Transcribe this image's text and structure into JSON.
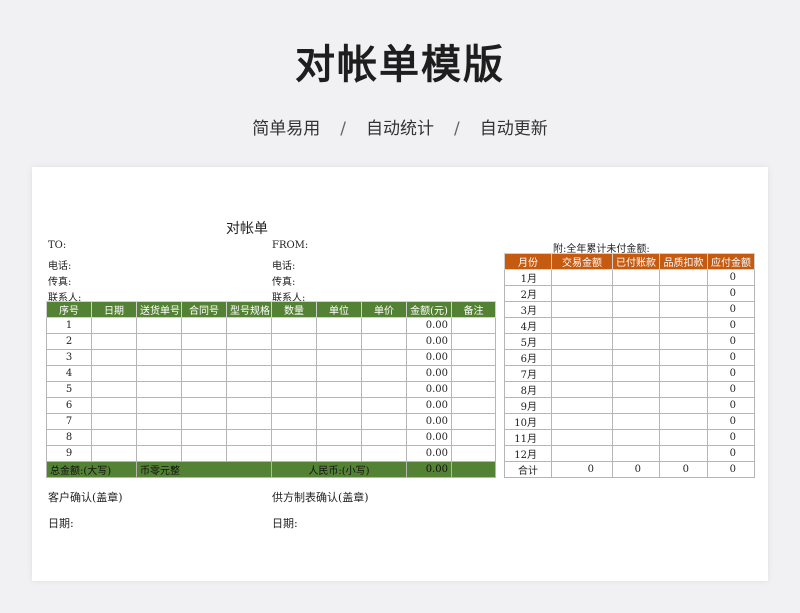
{
  "hero": {
    "title": "对帐单模版",
    "features": [
      "简单易用",
      "自动统计",
      "自动更新"
    ],
    "separator": "/"
  },
  "doc": {
    "title": "对帐单",
    "left_fields": [
      "TO:",
      "电话:",
      "传真:",
      "联系人:"
    ],
    "right_fields": [
      "FROM:",
      "电话:",
      "传真:",
      "联系人:"
    ],
    "side_title": "附:全年累计未付金额:",
    "main_table": {
      "headers": [
        "序号",
        "日期",
        "送货单号",
        "合同号",
        "型号规格",
        "数量",
        "单位",
        "单价",
        "金额(元)",
        "备注"
      ],
      "rows": [
        {
          "no": "1",
          "amount": "0.00"
        },
        {
          "no": "2",
          "amount": "0.00"
        },
        {
          "no": "3",
          "amount": "0.00"
        },
        {
          "no": "4",
          "amount": "0.00"
        },
        {
          "no": "5",
          "amount": "0.00"
        },
        {
          "no": "6",
          "amount": "0.00"
        },
        {
          "no": "7",
          "amount": "0.00"
        },
        {
          "no": "8",
          "amount": "0.00"
        },
        {
          "no": "9",
          "amount": "0.00"
        }
      ],
      "total": {
        "label": "总金额:(大写)",
        "chinese_amount": "币零元整",
        "rmb_label": "人民币:(小写)",
        "amount": "0.00"
      }
    },
    "side_table": {
      "headers": [
        "月份",
        "交易金额",
        "已付账款",
        "品质扣款",
        "应付金额"
      ],
      "rows": [
        {
          "month": "1月",
          "due": "0"
        },
        {
          "month": "2月",
          "due": "0"
        },
        {
          "month": "3月",
          "due": "0"
        },
        {
          "month": "4月",
          "due": "0"
        },
        {
          "month": "5月",
          "due": "0"
        },
        {
          "month": "6月",
          "due": "0"
        },
        {
          "month": "7月",
          "due": "0"
        },
        {
          "month": "8月",
          "due": "0"
        },
        {
          "month": "9月",
          "due": "0"
        },
        {
          "month": "10月",
          "due": "0"
        },
        {
          "month": "11月",
          "due": "0"
        },
        {
          "month": "12月",
          "due": "0"
        }
      ],
      "total": {
        "label": "合计",
        "values": [
          "0",
          "0",
          "0",
          "0"
        ]
      }
    },
    "footer": {
      "customer_confirm": "客户确认(盖章)",
      "supplier_confirm": "供方制表确认(盖章)",
      "date_left": "日期:",
      "date_right": "日期:"
    }
  },
  "colors": {
    "main_header": "#548235",
    "side_header": "#c55a11"
  }
}
